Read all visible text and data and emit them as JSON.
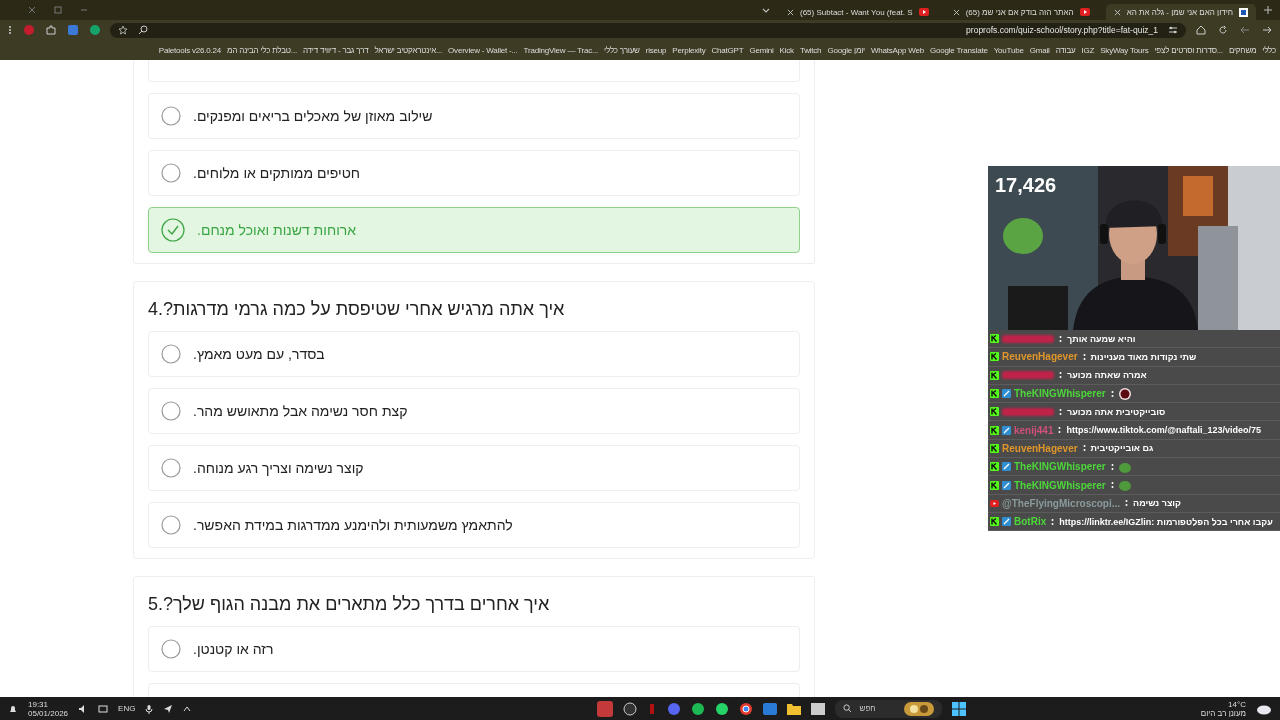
{
  "browser": {
    "tabs": [
      {
        "title": "חידון האם אני שמן - גלה את הא",
        "selected": true
      },
      {
        "title": "(65) האתר הזה בודק אם אני שמ",
        "selected": false
      },
      {
        "title": "(65) Subtact - Want You (feat. S",
        "selected": false
      }
    ],
    "address": "proprofs.com/quiz-school/story.php?title=fat-quiz_1",
    "bookmarks": [
      "כללי",
      "משחקים",
      "סדרות וסרטים לצפי...",
      "SkyWay Tours",
      "IGZ",
      "עבודה",
      "Gmail",
      "YouTube",
      "Google Translate",
      "WhatsApp Web",
      "Google יומן",
      "Twitch",
      "Kick",
      "Gemini",
      "ChatGPT",
      "Perplexity",
      "riseup",
      "שעורך כללי",
      "TradingView — Trac...",
      "Overview - Wallet -...",
      "אינטראקטיב ישראל...",
      "דרך גבר - דיוויד דידה",
      "טבלת כלי הבינה המ...",
      "Paletools v26.0.24"
    ]
  },
  "quiz": [
    {
      "options": [
        {
          "kind": "clipped"
        },
        {
          "kind": "option",
          "text": "שילוב מאוזן של מאכלים בריאים ומפנקים.",
          "correct": false
        },
        {
          "kind": "option",
          "text": "חטיפים ממותקים או מלוחים.",
          "correct": false
        },
        {
          "kind": "option",
          "text": "ארוחות דשנות ואוכל מנחם.",
          "correct": true
        }
      ]
    },
    {
      "title": "איך אתה מרגיש אחרי שטיפסת על כמה גרמי מדרגות?.4",
      "options": [
        {
          "kind": "option",
          "text": "בסדר, עם מעט מאמץ.",
          "correct": false
        },
        {
          "kind": "option",
          "text": "קצת חסר נשימה אבל מתאושש מהר.",
          "correct": false
        },
        {
          "kind": "option",
          "text": "קוצר נשימה וצריך רגע מנוחה.",
          "correct": false
        },
        {
          "kind": "option",
          "text": "להתאמץ משמעותית ולהימנע ממדרגות במידת האפשר.",
          "correct": false
        }
      ]
    },
    {
      "title": "איך אחרים בדרך כלל מתארים את מבנה הגוף שלך?.5",
      "options": [
        {
          "kind": "option",
          "text": "רזה או קטנטן.",
          "correct": false
        },
        {
          "kind": "clipped"
        }
      ]
    }
  ],
  "stream": {
    "viewers": "17,426",
    "chat": [
      {
        "kind": "kick",
        "mod": false,
        "redacted": true,
        "color": "#c0234a",
        "text": "והיא שמעה אותך"
      },
      {
        "kind": "kick",
        "mod": false,
        "redacted": false,
        "user": "ReuvenHagever",
        "color": "#e0962a",
        "text": "שתי נקודות מאוד מעניינות"
      },
      {
        "kind": "kick",
        "mod": false,
        "redacted": true,
        "color": "#c0234a",
        "text": "אמרה שאתה מכוער"
      },
      {
        "kind": "kick",
        "mod": true,
        "redacted": false,
        "user": "TheKINGWhisperer",
        "color": "#4cd63a",
        "emotes": [
          {
            "kind": "dot"
          }
        ]
      },
      {
        "kind": "kick",
        "mod": false,
        "redacted": true,
        "color": "#c0234a",
        "text": "סובייקטיבית אתה מכוער"
      },
      {
        "kind": "kick",
        "mod": true,
        "redacted": false,
        "user": "kenij441",
        "color": "#d0507a",
        "text": "https://www.tiktok.com/@naftali_123/video/75"
      },
      {
        "kind": "kick",
        "mod": false,
        "redacted": false,
        "user": "ReuvenHagever",
        "color": "#e0962a",
        "text": "גם אובייקטיבית"
      },
      {
        "kind": "kick",
        "mod": true,
        "redacted": false,
        "user": "TheKINGWhisperer",
        "color": "#4cd63a",
        "emotes": [
          {
            "kind": "frog"
          }
        ]
      },
      {
        "kind": "kick",
        "mod": true,
        "redacted": false,
        "user": "TheKINGWhisperer",
        "color": "#4cd63a",
        "emotes": [
          {
            "kind": "frog"
          }
        ]
      },
      {
        "kind": "youtube",
        "mod": false,
        "redacted": false,
        "user": "@TheFlyingMicroscopi...",
        "color": "#8a9a9a",
        "text": "קוצר נשימה"
      },
      {
        "kind": "kick",
        "mod": true,
        "redacted": false,
        "user": "BotRix",
        "color": "#4cd63a",
        "text": "עקבו אחרי בכל הפלטפורמות :https://linktr.ee/IGZlin"
      }
    ]
  },
  "taskbar": {
    "time": "19:31",
    "date": "05/01/2026",
    "language": "ENG",
    "search_placeholder": "חפש",
    "temperature": "14°C",
    "weather": "מעונן רב היום"
  }
}
